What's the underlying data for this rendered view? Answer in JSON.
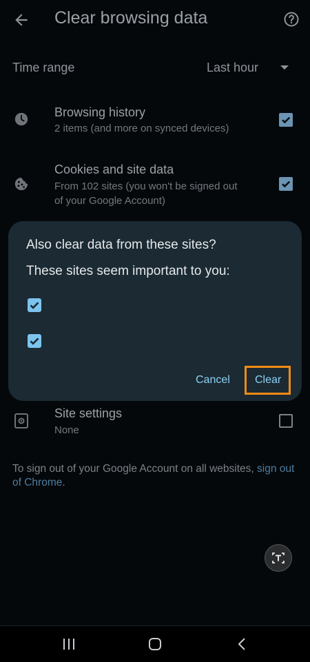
{
  "header": {
    "title": "Clear browsing data",
    "back_icon": "arrow-left",
    "help_icon": "help-circle"
  },
  "time_range": {
    "label": "Time range",
    "value": "Last hour"
  },
  "options": [
    {
      "title": "Browsing history",
      "subtitle": "2 items (and more on synced devices)",
      "icon": "clock-icon",
      "checked": true
    },
    {
      "title": "Cookies and site data",
      "subtitle_line1": "From 102 sites (you won't be signed out",
      "subtitle_line2": "of your Google Account)",
      "icon": "cookie-icon",
      "checked": true
    },
    {
      "title": "Site settings",
      "subtitle": "None",
      "icon": "site-settings-icon",
      "checked": false
    }
  ],
  "footer": {
    "text": "To sign out of your Google Account on all websites, ",
    "link": "sign out of Chrome",
    "after": "."
  },
  "dialog": {
    "title": "Also clear data from these sites?",
    "subtitle": "These sites seem important to you:",
    "sites": [
      {
        "checked": true
      },
      {
        "checked": true
      }
    ],
    "cancel_label": "Cancel",
    "clear_label": "Clear"
  },
  "colors": {
    "accent": "#8fd1f5",
    "dialog_bg": "#1b2a33",
    "highlight": "#f28c14",
    "checkbox": "#7cc4ee"
  }
}
